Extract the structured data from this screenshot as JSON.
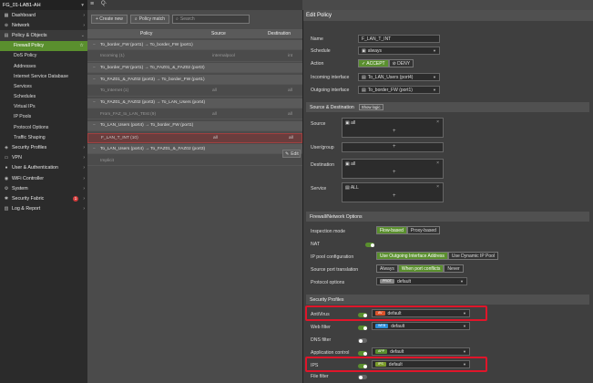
{
  "sidebar": {
    "device": "FG_01-LAB1-AH",
    "items": [
      {
        "label": "Dashboard",
        "icon": "dashboard-icon"
      },
      {
        "label": "Network",
        "icon": "network-icon"
      },
      {
        "label": "Policy & Objects",
        "icon": "policy-icon"
      }
    ],
    "sub_items": [
      "Firewall Policy",
      "DoS Policy",
      "Addresses",
      "Internet Service Database",
      "Services",
      "Schedules",
      "Virtual IPs",
      "IP Pools",
      "Protocol Options",
      "Traffic Shaping"
    ],
    "items2": [
      {
        "label": "Security Profiles",
        "icon": "security-icon"
      },
      {
        "label": "VPN",
        "icon": "vpn-icon"
      },
      {
        "label": "User & Authentication",
        "icon": "user-icon"
      },
      {
        "label": "WiFi Controller",
        "icon": "wifi-icon"
      },
      {
        "label": "System",
        "icon": "gear-icon"
      },
      {
        "label": "Security Fabric",
        "icon": "fabric-icon",
        "badge": "1"
      },
      {
        "label": "Log & Report",
        "icon": "log-icon"
      }
    ]
  },
  "toolbar": {
    "create": "+ Create new",
    "policy_match": "Policy match",
    "search_placeholder": "Search"
  },
  "table": {
    "headers": [
      "Policy",
      "Source",
      "Destination"
    ],
    "rows": [
      {
        "c1": "To_border_FW (port1) → To_border_FW (port1)",
        "type": "group"
      },
      {
        "c1": "Incoming (1)",
        "c2": "internalpool",
        "c3": "int",
        "type": "dim"
      },
      {
        "c1": "To_border_FW (port1) → To_FAZ01_&_FAZ02 (port3)",
        "type": "group"
      },
      {
        "c1": "To_FAZ01_&_FAZ02 (port3) → To_border_FW (port1)",
        "type": "group"
      },
      {
        "c1": "To_Internet (1)",
        "c2": "all",
        "c3": "all",
        "type": "dim"
      },
      {
        "c1": "To_FAZ01_&_FAZ02 (port3) → To_LAN_Users (port4)",
        "type": "group"
      },
      {
        "c1": "From_FAZ_to_LAN_TEst (9)",
        "c2": "all",
        "c3": "all",
        "type": "dim"
      },
      {
        "c1": "To_LAN_Users (port4) → To_border_FW (port1)",
        "type": "group"
      },
      {
        "c1": "F_LAN_T_INT (10)",
        "c2": "all",
        "c3": "all",
        "type": "hl"
      },
      {
        "c1": "To_LAN_Users (port4) → To_FAZ01_&_FAZ02 (port3)",
        "type": "group"
      },
      {
        "c1": "Implicit",
        "type": "dim"
      }
    ],
    "edit_label": "Edit"
  },
  "panel": {
    "title": "Edit Policy",
    "name_label": "Name",
    "name_value": "F_LAN_T_INT",
    "schedule_label": "Schedule",
    "schedule_value": "always",
    "action_label": "Action",
    "action_accept": "✓ ACCEPT",
    "action_deny": "⊘ DENY",
    "incoming_label": "Incoming interface",
    "incoming_value": "To_LAN_Users (port4)",
    "outgoing_label": "Outgoing interface",
    "outgoing_value": "To_border_FW (port1)",
    "sd_section": "Source & Destination",
    "show_logic": "Show logic",
    "source_label": "Source",
    "source_value": "all",
    "usergroup_label": "User/group",
    "dest_label": "Destination",
    "dest_value": "all",
    "service_label": "Service",
    "service_value": "ALL",
    "fw_section": "Firewall/Network Options",
    "inspection_label": "Inspection mode",
    "flow": "Flow-based",
    "proxy": "Proxy-based",
    "nat_label": "NAT",
    "ippool_label": "IP pool configuration",
    "ippool_opt1": "Use Outgoing Interface Address",
    "ippool_opt2": "Use Dynamic IP Pool",
    "spt_label": "Source port translation",
    "spt_always": "Always",
    "spt_conflict": "When port conflicts",
    "spt_never": "Never",
    "proto_label": "Protocol options",
    "proto_tag": "PROT",
    "proto_value": "default",
    "sp_section": "Security Profiles",
    "av_label": "AntiVirus",
    "av_tag": "AV",
    "av_value": "default",
    "web_label": "Web filter",
    "web_tag": "WEB",
    "web_value": "default",
    "dns_label": "DNS filter",
    "app_label": "Application control",
    "app_tag": "APP",
    "app_value": "default",
    "ips_label": "IPS",
    "ips_tag": "IPS",
    "ips_value": "default",
    "file_label": "File filter"
  }
}
